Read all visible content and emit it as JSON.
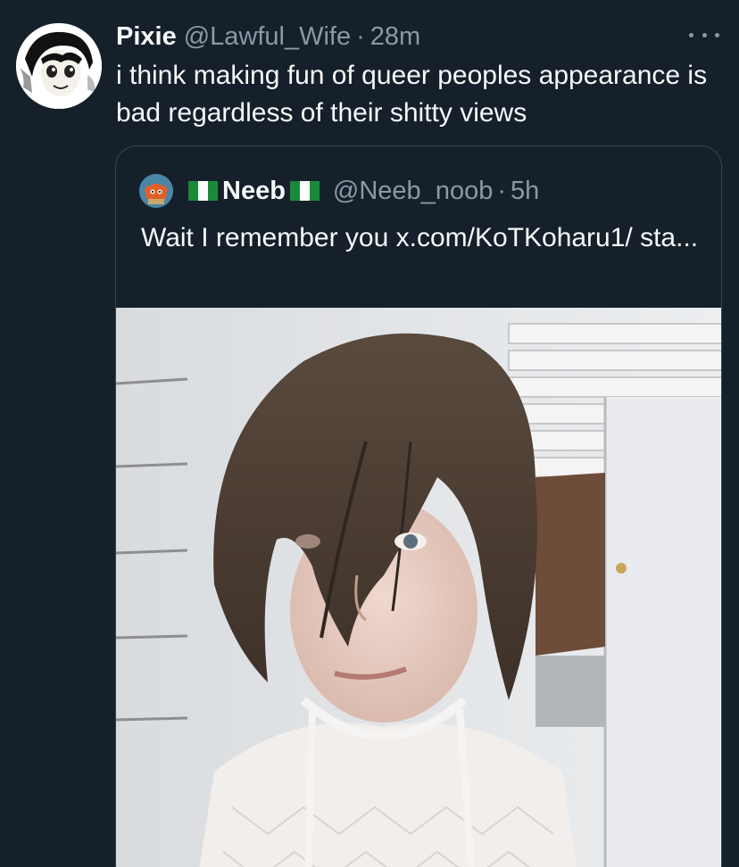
{
  "tweet": {
    "display_name": "Pixie",
    "handle": "@Lawful_Wife",
    "separator": "·",
    "timestamp": "28m",
    "text": "i think making fun of queer peoples appearance is bad regardless of their shitty views",
    "avatar_icon": "manga-character-avatar",
    "more_icon": "more-options-icon"
  },
  "quote": {
    "display_name": "Neeb",
    "flag_icon": "nigeria-flag-icon",
    "handle": "@Neeb_noob",
    "separator": "·",
    "timestamp": "5h",
    "text": "Wait I remember you x.com/KoTKoharu1/ sta...",
    "avatar_icon": "cartoon-creature-avatar",
    "media": "selfie-photo"
  },
  "colors": {
    "background": "#15202b",
    "primary_text": "#f7f9f9",
    "secondary_text": "#8b98a5",
    "card_border": "#38444d"
  }
}
